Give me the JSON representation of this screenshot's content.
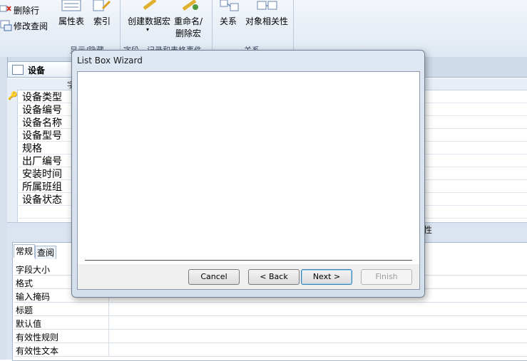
{
  "ribbon": {
    "delete_row": "删除行",
    "modify_lookup": "修改查阅",
    "property_sheet": "属性表",
    "indexes": "索引",
    "create_macro": "创建数据宏",
    "create_macro_arrow": "▾",
    "rename_macro_1": "重命名/",
    "rename_macro_2": "删除宏",
    "relationships": "关系",
    "dependencies": "对象相关性",
    "group_show_hide": "显示/隐藏",
    "group_field_events": "字段、记录和表格事件",
    "group_relationships": "关系"
  },
  "document": {
    "tab_title": "设备",
    "column_header": "字",
    "fields": [
      "设备类型",
      "设备编号",
      "设备名称",
      "设备型号",
      "规格",
      "出厂编号",
      "安装时间",
      "所属班组",
      "设备状态"
    ],
    "field_properties_label": "性"
  },
  "properties": {
    "tabs": [
      "常规",
      "查阅"
    ],
    "rows": [
      "字段大小",
      "格式",
      "输入掩码",
      "标题",
      "默认值",
      "有效性规则",
      "有效性文本"
    ]
  },
  "dialog": {
    "title": "List Box Wizard",
    "cancel": "Cancel",
    "back": "< Back",
    "next": "Next >",
    "finish": "Finish"
  }
}
